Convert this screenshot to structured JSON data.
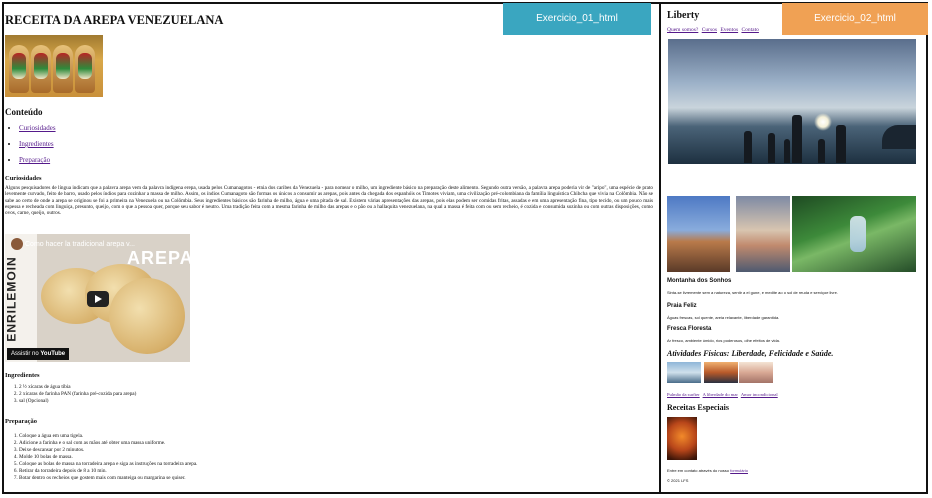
{
  "tabs": {
    "left_label": "Exercicio_01_html",
    "right_label": "Exercicio_02_html"
  },
  "left": {
    "title": "RECEITA DA AREPA VENEZUELANA",
    "contents_title": "Conteúdo",
    "toc": [
      "Curiosidades",
      "Ingredientes",
      "Preparação"
    ],
    "curiosities_title": "Curiosidades",
    "curiosities_text": "Alguns pesquisadores de língua indicam que a palavra arepa vem da palavra indígena erepa, usada pelos Cumanagotos - etnia dos caribes da Venezuela - para nomear o milho, um ingrediente básico na preparação deste alimento. Segundo outra versão, a palavra arepa poderia vir de \"aripo\", uma espécie de prato levemente curvado, feito de barro, usado pelos índios para cozinhar a massa de milho. Assim, os índios Cumanagoto são formas os únicos a consumir as arepas, pois antes da chegada dos espanhóis os Timotes viviam, uma civilização pré-colombiana da família linguística Chibcha que vivia na Colômbia. Não se sabe ao certo de onde a arepa se originou se foi a primeira na Venezuela ou na Colômbia. Seus ingredientes básicos são farinha de milho, água e uma pitada de sal. Existem várias apresentações das arepas, pois elas podem ser comidas fritas, assadas e em uma apresentação fina, tipo tecido, ou um pouco mais espessa e recheada com linguiça, presunto, queijo, com o que a pessoa quer, porque seu sabor é neutro. Uma tradição feita com a mesma farinha de milho das arepas e o pão ou a hallaquita venezuelana, na qual a massa é feita com ou sem recheio, é cozida e consumida sozinha ou com outras disposições, como ovos, carne, queijo, outros.",
    "video": {
      "title": "Como hacer la tradicional arepa v...",
      "brand": "AREPAS",
      "side_text": "ENRILEMOIN",
      "watch_label": "Assistir no",
      "yt_label": "YouTube"
    },
    "ingredients_title": "Ingredientes",
    "ingredients": [
      "2 ½ xícaras de água tíbia",
      "2 xícaras de farinha PAN (farinha pré-cozida para arepa)",
      "sal (Opcional)"
    ],
    "prep_title": "Preparação",
    "prep_steps": [
      "Coloque a água em uma tigela.",
      "Adicione a farinha e o sal com as mãos até obter uma massa uniforme.",
      "Deixe descansar por 2 minutos.",
      "Molde 10 bolas de massa.",
      "Coloque as bolas de massa na torradeira arepa e siga as instruções na torradeira arepa.",
      "Retirar da torradeira depois de 8 a 10 min.",
      "Botar dentro os recheios que gostem mais com manteiga ou margarina se quiser."
    ]
  },
  "right": {
    "title": "Liberty",
    "nav": [
      "Quem somos?",
      "Cursos",
      "Eventos",
      "Contato"
    ],
    "sections": [
      {
        "title": "Montanha dos Sonhos",
        "text": "Sinta-se livremente sem a natureza, sentir a el gune, e medite ao o sol de reuda e serviçoe livre."
      },
      {
        "title": "Praia Feliz",
        "text": "Águas frescas, sol quente, areia relaxante, liberdade garantida."
      },
      {
        "title": "Fresca Floresta",
        "text": "Ar fresco, ambiente úmido, rios poderosos, olhe efeitos de vida."
      }
    ],
    "activities_title": "Atividades Físicas: Liberdade, Felicidade e Saúde.",
    "activity_links": [
      "Pulmão da surfter",
      "A liberdade do mar",
      "Amor incondicional"
    ],
    "recipes_title": "Receitas Especiais",
    "footer_text": "Entre em contato através do nosso",
    "footer_link": "formulário",
    "copyright": "© 2021 LFS"
  }
}
